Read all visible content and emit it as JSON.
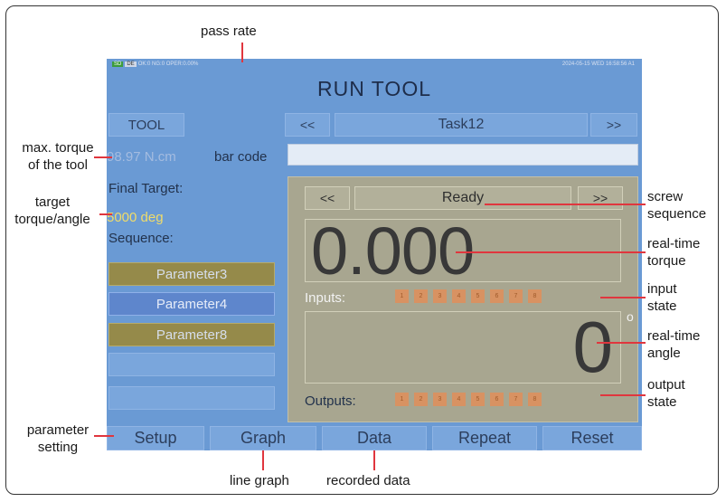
{
  "screen": {
    "status_left_sd": "SD",
    "status_left_de": "DE",
    "status_left_text": "OK:0 NG:0 OPER:0.00%",
    "status_right": "2024-05-15 WED 16:58:56",
    "status_right_tail": "A1",
    "title": "RUN TOOL",
    "tool_button": "TOOL",
    "prev_task": "<<",
    "task_name": "Task12",
    "next_task": ">>",
    "max_torque": "98.97 N.cm",
    "bar_code_label": "bar code",
    "bar_code_value": "",
    "final_target_label": "Final Target:",
    "target_value": "5000 deg",
    "sequence_label": "Sequence:",
    "sequence_items": [
      "Parameter3",
      "Parameter4",
      "Parameter8",
      "",
      ""
    ],
    "panel": {
      "prev_step": "<<",
      "step_state": "Ready",
      "next_step": ">>",
      "torque_value": "0.000",
      "inputs_label": "Inputs:",
      "inputs": [
        "1",
        "2",
        "3",
        "4",
        "5",
        "6",
        "7",
        "8"
      ],
      "angle_value": "0",
      "degree_mark": "o",
      "outputs_label": "Outputs:",
      "outputs": [
        "1",
        "2",
        "3",
        "4",
        "5",
        "6",
        "7",
        "8"
      ]
    },
    "bottom_buttons": {
      "setup": "Setup",
      "graph": "Graph",
      "data": "Data",
      "repeat": "Repeat",
      "reset": "Reset"
    }
  },
  "annotations": {
    "pass_rate": "pass rate",
    "max_torque_1": "max. torque",
    "max_torque_2": "of the tool",
    "target_1": "target",
    "target_2": "torque/angle",
    "screw_1": "screw",
    "screw_2": "sequence",
    "rt_torque_1": "real-time",
    "rt_torque_2": "torque",
    "input_1": "input",
    "input_2": "state",
    "rt_angle_1": "real-time",
    "rt_angle_2": "angle",
    "output_1": "output",
    "output_2": "state",
    "param_1": "parameter",
    "param_2": "setting",
    "line_graph": "line graph",
    "recorded_data": "recorded data"
  },
  "colors": {
    "screen_bg": "#6a9ad4",
    "panel_bg": "#a8a690",
    "leader_line": "#e0363e",
    "io_led": "#d89262"
  }
}
